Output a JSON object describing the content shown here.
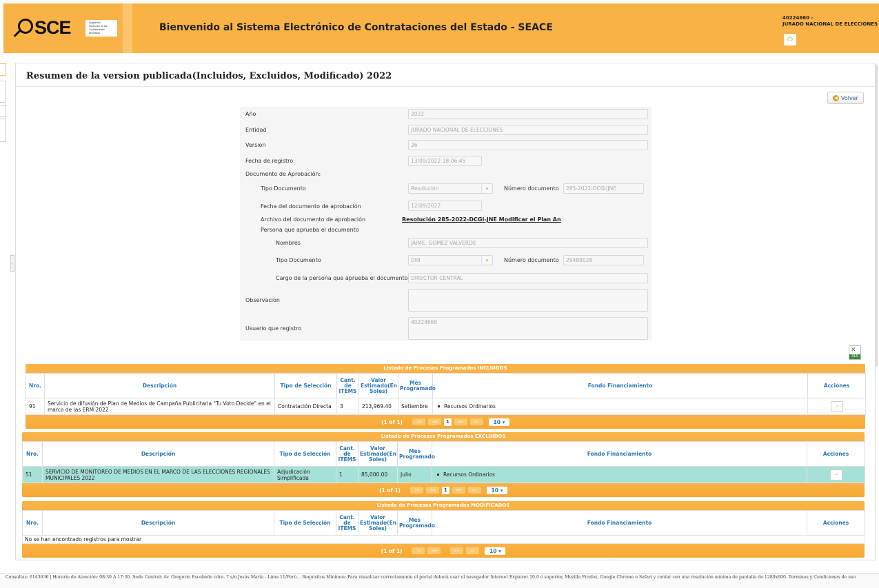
{
  "header": {
    "logo_text": "SCE",
    "logo_sub": [
      "Organismo",
      "Supervisor de las",
      "Contrataciones",
      "del Estado"
    ],
    "title": "Bienvenido al Sistema Electrónico de Contrataciones del Estado - SEACE",
    "user_id": "40224660 -",
    "user_entity": "JURADO NACIONAL DE ELECCIONES",
    "power_icon": "power-icon"
  },
  "page": {
    "title": "Resumen de la version publicada(Incluidos, Excluidos, Modificado) 2022",
    "volver_label": "Volver"
  },
  "form": {
    "anio_label": "Año",
    "anio_value": "2022",
    "entidad_label": "Entidad",
    "entidad_value": "JURADO NACIONAL DE ELECCIONES",
    "version_label": "Version",
    "version_value": "26",
    "fecha_label": "Fecha de registro",
    "fecha_value": "13/09/2022 18:06:45",
    "doc_aprob_label": "Documento de Aprobación:",
    "tipo_doc_label": "Tipo Documento",
    "tipo_doc_value": "Resolución",
    "num_doc_label": "Número documento",
    "num_doc_value": "285-2022-DCGI/JNE",
    "fecha_doc_label": "Fecha del documento de aprobación",
    "fecha_doc_value": "12/09/2022",
    "archivo_label": "Archivo del documento de aprobación",
    "archivo_link": "Resolución 285-2022-DCGI-JNE Modificar el Plan An",
    "persona_label": "Persona que aprueba el documento",
    "nombres_label": "Nombres",
    "nombres_value": "JAIME, GOMEZ VALVERDE",
    "p_tipo_doc_label": "Tipo Documento",
    "p_tipo_doc_value": "DNI",
    "p_num_doc_label": "Número documento",
    "p_num_doc_value": "29489028",
    "cargo_label": "Cargo de la persona que aprueba el documento",
    "cargo_value": "DIRECTOR CENTRAL",
    "observacion_label": "Observacion",
    "observacion_value": "",
    "usuario_label": "Usuario que registro",
    "usuario_value": "40224660"
  },
  "xls": {
    "label": "XLS"
  },
  "columns": {
    "nro": "Nro.",
    "descripcion": "Descripción",
    "tipo": "Tipo de Selección",
    "cant": "Cant. de ITEMS",
    "valor": "Valor Estimado(En Soles)",
    "mes": "Mes Programado",
    "fondo": "Fondo Financiamiento",
    "acciones": "Acciones"
  },
  "incluidos": {
    "title": "Listado de Procesos Programados INCLUIDOS",
    "rows": [
      {
        "nro": "91",
        "descripcion": "Servicio de difusión de Plan de Medios de Campaña Publicitaria \"Tu Voto Decide\" en el marco de las ERM 2022",
        "tipo": "Contratación Directa",
        "cant": "3",
        "valor": "213,969.40",
        "mes": "Setiembre",
        "fondo": "Recursos Ordinarios"
      }
    ],
    "pager": "(1 of 1)",
    "page": "1",
    "page_size": "10 ▾"
  },
  "excluidos": {
    "title": "Listado de Procesos Programados EXCLUIDOS",
    "rows": [
      {
        "nro": "51",
        "descripcion": "SERVICIO DE MONITOREO DE MEDIOS EN EL MARCO DE LAS ELECCIONES REGIONALES MUNICIPALES 2022",
        "tipo": "Adjudicación Simplificada",
        "cant": "1",
        "valor": "85,000.00",
        "mes": "Julio",
        "fondo": "Recursos Ordinarios"
      }
    ],
    "pager": "(1 of 1)",
    "page": "1",
    "page_size": "10 ▾"
  },
  "modificados": {
    "title": "Listado de Procesos Programados MODIFICADOS",
    "empty_message": "No se han encontrado registros para mostrar",
    "pager": "(1 of 1)",
    "page_size": "10 ▾"
  },
  "footer": {
    "text": "Consultas: 6143636 | Horario de Atención: 08:30 A 17:30. Sede Central: Av. Gregorio Escobedo cdra. 7 s/n Jesús María - Lima 11/Perú... Requisitos Mínimos: Para visualizar correctamente el portal deberá usar el navegador Internet Explorer 10.0 ó superior, Mozilla Firefox, Google Chrome o Safari y contar con una resolución mínima de pantalla de 1280x600. Terminos y Condiciones de uso"
  }
}
